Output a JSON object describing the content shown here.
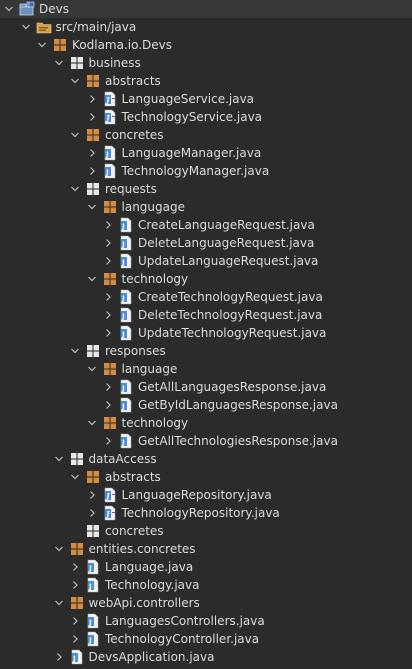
{
  "tree": [
    {
      "label": "Devs",
      "depth": 0,
      "kind": "project",
      "toggle": "expanded"
    },
    {
      "label": "src/main/java",
      "depth": 1,
      "kind": "srcfolder",
      "toggle": "expanded"
    },
    {
      "label": "Kodlama.io.Devs",
      "depth": 2,
      "kind": "package",
      "toggle": "expanded"
    },
    {
      "label": "business",
      "depth": 3,
      "kind": "package-empty",
      "toggle": "expanded"
    },
    {
      "label": "abstracts",
      "depth": 4,
      "kind": "package",
      "toggle": "expanded"
    },
    {
      "label": "LanguageService.java",
      "depth": 5,
      "kind": "interface",
      "toggle": "collapsed"
    },
    {
      "label": "TechnologyService.java",
      "depth": 5,
      "kind": "interface",
      "toggle": "collapsed"
    },
    {
      "label": "concretes",
      "depth": 4,
      "kind": "package",
      "toggle": "expanded"
    },
    {
      "label": "LanguageManager.java",
      "depth": 5,
      "kind": "class",
      "toggle": "collapsed"
    },
    {
      "label": "TechnologyManager.java",
      "depth": 5,
      "kind": "class",
      "toggle": "collapsed"
    },
    {
      "label": "requests",
      "depth": 4,
      "kind": "package-empty",
      "toggle": "expanded"
    },
    {
      "label": "langugage",
      "depth": 5,
      "kind": "package",
      "toggle": "expanded"
    },
    {
      "label": "CreateLanguageRequest.java",
      "depth": 6,
      "kind": "class",
      "toggle": "collapsed"
    },
    {
      "label": "DeleteLanguageRequest.java",
      "depth": 6,
      "kind": "class",
      "toggle": "collapsed"
    },
    {
      "label": "UpdateLanguageRequest.java",
      "depth": 6,
      "kind": "class",
      "toggle": "collapsed"
    },
    {
      "label": "technology",
      "depth": 5,
      "kind": "package",
      "toggle": "expanded"
    },
    {
      "label": "CreateTechnologyRequest.java",
      "depth": 6,
      "kind": "class",
      "toggle": "collapsed"
    },
    {
      "label": "DeleteTechnologyRequest.java",
      "depth": 6,
      "kind": "class",
      "toggle": "collapsed"
    },
    {
      "label": "UpdateTechnologyRequest.java",
      "depth": 6,
      "kind": "class",
      "toggle": "collapsed"
    },
    {
      "label": "responses",
      "depth": 4,
      "kind": "package-empty",
      "toggle": "expanded"
    },
    {
      "label": "language",
      "depth": 5,
      "kind": "package",
      "toggle": "expanded"
    },
    {
      "label": "GetAllLanguagesResponse.java",
      "depth": 6,
      "kind": "class",
      "toggle": "collapsed"
    },
    {
      "label": "GetByIdLanguagesResponse.java",
      "depth": 6,
      "kind": "class",
      "toggle": "collapsed"
    },
    {
      "label": "technology",
      "depth": 5,
      "kind": "package",
      "toggle": "expanded"
    },
    {
      "label": "GetAllTechnologiesResponse.java",
      "depth": 6,
      "kind": "class",
      "toggle": "collapsed"
    },
    {
      "label": "dataAccess",
      "depth": 3,
      "kind": "package-empty",
      "toggle": "expanded"
    },
    {
      "label": "abstracts",
      "depth": 4,
      "kind": "package",
      "toggle": "expanded"
    },
    {
      "label": "LanguageRepository.java",
      "depth": 5,
      "kind": "interface",
      "toggle": "collapsed"
    },
    {
      "label": "TechnologyRepository.java",
      "depth": 5,
      "kind": "interface",
      "toggle": "collapsed"
    },
    {
      "label": "concretes",
      "depth": 4,
      "kind": "package-empty",
      "toggle": "none"
    },
    {
      "label": "entities.concretes",
      "depth": 3,
      "kind": "package",
      "toggle": "expanded"
    },
    {
      "label": "Language.java",
      "depth": 4,
      "kind": "class",
      "toggle": "collapsed"
    },
    {
      "label": "Technology.java",
      "depth": 4,
      "kind": "class",
      "toggle": "collapsed"
    },
    {
      "label": "webApi.controllers",
      "depth": 3,
      "kind": "package",
      "toggle": "expanded"
    },
    {
      "label": "LanguagesControllers.java",
      "depth": 4,
      "kind": "class",
      "toggle": "collapsed"
    },
    {
      "label": "TechnologyController.java",
      "depth": 4,
      "kind": "class",
      "toggle": "collapsed"
    },
    {
      "label": "DevsApplication.java",
      "depth": 3,
      "kind": "class",
      "toggle": "collapsed"
    }
  ],
  "icon_names": {
    "project": "project-folder-icon",
    "srcfolder": "source-folder-icon",
    "package": "package-icon",
    "package-empty": "empty-package-icon",
    "interface": "java-interface-file-icon",
    "class": "java-class-file-icon"
  },
  "colors": {
    "background": "#2b2b2b",
    "text": "#dcdcdc",
    "chevron": "#bdbdbd",
    "package": "#d68a3e",
    "package_empty": "#e6e6e6",
    "java_file": "#4a8fd6",
    "folder": "#d7a14a"
  }
}
